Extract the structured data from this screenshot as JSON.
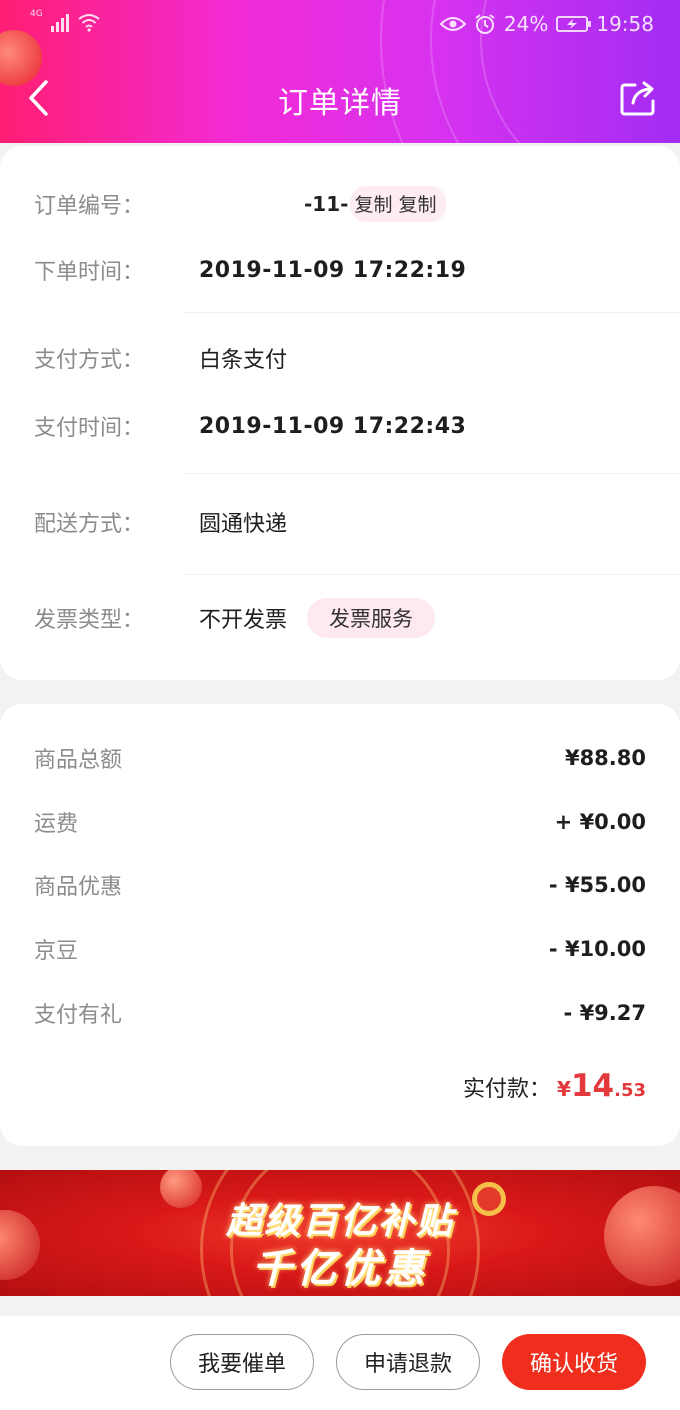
{
  "status_bar": {
    "network": "4G",
    "battery": "24%",
    "time": "19:58"
  },
  "header": {
    "title": "订单详情",
    "back_icon": "chevron-left-icon",
    "share_icon": "share-icon"
  },
  "order_info": {
    "order_number_label": "订单编号：",
    "order_number_value": "-11-",
    "copy_label": "复制 复制",
    "order_time_label": "下单时间：",
    "order_time_value": "2019-11-09 17:22:19",
    "payment_method_label": "支付方式：",
    "payment_method_value": "白条支付",
    "payment_time_label": "支付时间：",
    "payment_time_value": "2019-11-09 17:22:43",
    "delivery_label": "配送方式：",
    "delivery_value": "圆通快递",
    "invoice_label": "发票类型：",
    "invoice_value": "不开发票",
    "invoice_service_label": "发票服务"
  },
  "amounts": {
    "items": [
      {
        "label": "商品总额",
        "value": "¥88.80"
      },
      {
        "label": "运费",
        "value": "+ ¥0.00"
      },
      {
        "label": "商品优惠",
        "value": "- ¥55.00"
      },
      {
        "label": "京豆",
        "value": "- ¥10.00"
      },
      {
        "label": "支付有礼",
        "value": "- ¥9.27"
      }
    ],
    "paid_label": "实付款：",
    "paid_currency": "¥",
    "paid_int": "14",
    "paid_dec": ".53"
  },
  "banner": {
    "line1": "超级百亿补贴",
    "line2": "千亿优惠"
  },
  "actions": {
    "urge_label": "我要催单",
    "refund_label": "申请退款",
    "confirm_label": "确认收货"
  },
  "colors": {
    "accent_red": "#e4393c",
    "primary_button": "#f02e1e",
    "pill_bg": "#fde9ef"
  }
}
